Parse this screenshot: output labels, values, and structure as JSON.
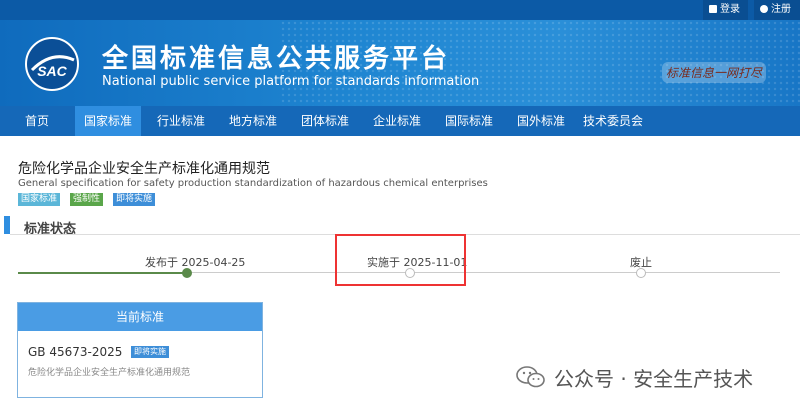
{
  "topbar": {
    "login_label": "登录",
    "register_label": "注册"
  },
  "header": {
    "logo_text": "SAC",
    "title": "全国标准信息公共服务平台",
    "subtitle": "National public service platform  for standards information",
    "slogan": "标准信息一网打尽"
  },
  "nav": {
    "items": [
      {
        "label": "首页"
      },
      {
        "label": "国家标准",
        "active": true
      },
      {
        "label": "行业标准"
      },
      {
        "label": "地方标准"
      },
      {
        "label": "团体标准"
      },
      {
        "label": "企业标准"
      },
      {
        "label": "国际标准"
      },
      {
        "label": "国外标准"
      },
      {
        "label": "技术委员会"
      }
    ]
  },
  "standard": {
    "title": "危险化学品企业安全生产标准化通用规范",
    "title_en": "General specification for safety production standardization of hazardous chemical enterprises",
    "tags": [
      "国家标准",
      "强制性",
      "即将实施"
    ]
  },
  "status": {
    "section_title": "标准状态",
    "timeline": [
      {
        "label": "发布于 2025-04-25",
        "done": true
      },
      {
        "label": "实施于 2025-11-01",
        "done": false
      },
      {
        "label": "废止",
        "done": false
      }
    ]
  },
  "current": {
    "header": "当前标准",
    "code": "GB 45673-2025",
    "badge": "即将实施",
    "desc": "危险化学品企业安全生产标准化通用规范"
  },
  "watermark": {
    "text": "公众号 · 安全生产技术"
  },
  "colors": {
    "header_blue": "#1876c6",
    "nav_blue": "#1568b8",
    "nav_active": "#2f8ee0",
    "highlight_red": "#ee3333",
    "done_green": "#5a8a4a"
  }
}
